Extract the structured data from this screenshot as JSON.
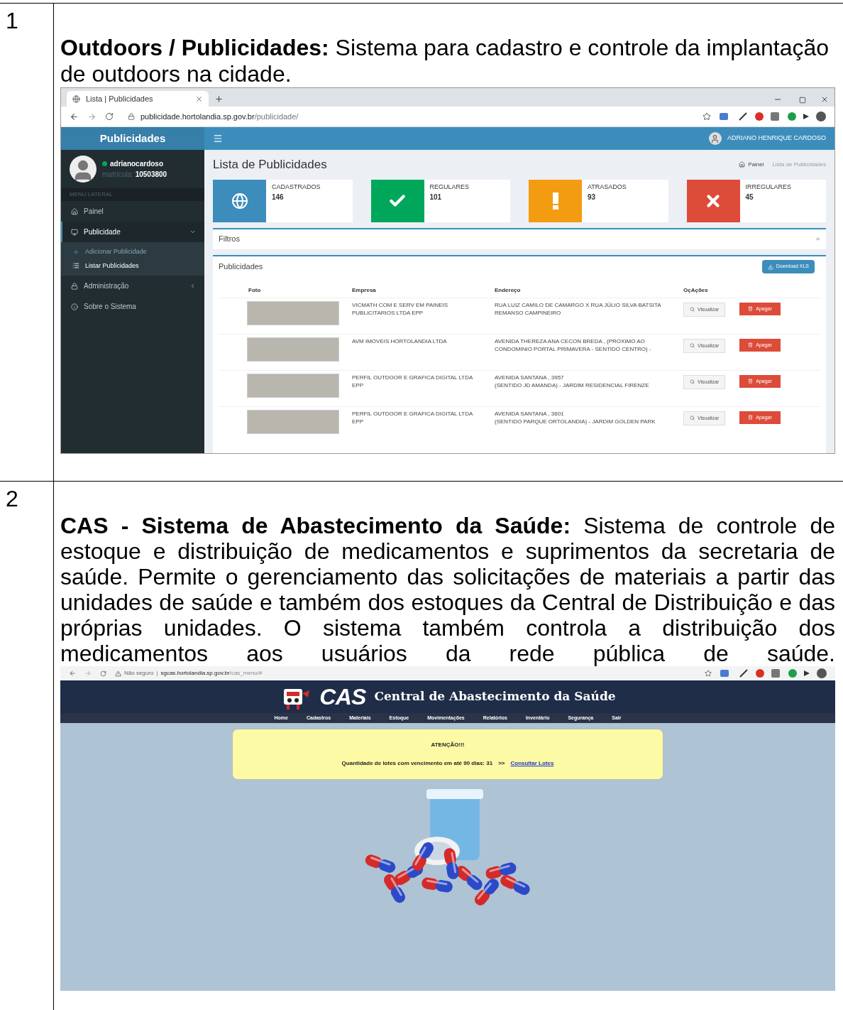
{
  "entries": [
    {
      "kind": "publicidades",
      "number": "1",
      "description": "**Outdoors / Publicidades:** Sistema para cadastro e controle da implantação de outdoors na cidade.",
      "browser": {
        "tab_title": "Lista | Publicidades",
        "url_host": "publicidade.hortolandia.sp.gov.br",
        "url_path": "/publicidade/"
      },
      "app": {
        "brand": "Publicidades",
        "user": "ADRIANO HENRIQUE CARDOSO",
        "username": "adrianocardoso",
        "matricula_label": "matrícula:",
        "matricula": "10503800",
        "menu_header": "MENU LATERAL",
        "menu": [
          {
            "kind": "link",
            "label": "Painel",
            "selected": false
          },
          {
            "kind": "group",
            "label": "Publicidade",
            "selected": true,
            "expanded": true,
            "children": [
              {
                "label": "Adicionar Publicidade",
                "selected": false
              },
              {
                "label": "Listar Publicidades",
                "selected": true
              }
            ]
          },
          {
            "kind": "group",
            "label": "Administração",
            "selected": false,
            "expanded": false
          },
          {
            "kind": "link",
            "label": "Sobre o Sistema",
            "selected": false
          }
        ],
        "page_title": "Lista de Publicidades",
        "breadcrumb": [
          "Painel",
          "Lista de Publicidades"
        ],
        "stats": [
          {
            "label": "CADASTRADOS",
            "value": "146",
            "color": "#3c8dbc"
          },
          {
            "label": "REGULARES",
            "value": "101",
            "color": "#00a65a"
          },
          {
            "label": "ATRASADOS",
            "value": "93",
            "color": "#f39c12"
          },
          {
            "label": "IRREGULARES",
            "value": "45",
            "color": "#dd4b39"
          }
        ],
        "filters": {
          "title": "Filtros",
          "toggle": "+"
        },
        "panel": {
          "title": "Publicidades",
          "button": "Download XLS",
          "columns": [
            "Foto",
            "Empresa",
            "Endereço",
            "OçAções"
          ],
          "rows": [
            {
              "empresa": "VICMATH COM E SERV EM PAINEIS PUBLICITARIOS LTDA EPP",
              "endereco": [
                "RUA LUIZ CAMILO DE CAMARGO X RUA JÚLIO SILVA BATSITA",
                "REMANSO CAMPINEIRO"
              ],
              "view": "Visualizar",
              "delete": "Apagar"
            },
            {
              "empresa": "AVM IMOVEIS HORTOLANDIA LTDA",
              "endereco": [
                "AVENIDA THEREZA ANA CECON BREDA , (PROXIMO AO CONDOMINIO PORTAL PRIMAVERA - SENTIDO CENTRO) -"
              ],
              "view": "Visualizar",
              "delete": "Apagar"
            },
            {
              "empresa": "PERFIL OUTDOOR E GRAFICA DIGITAL LTDA EPP",
              "endereco": [
                "AVENIDA SANTANA , 3957",
                "(SENTIDO JD AMANDA) - JARDIM RESIDENCIAL FIRENZE"
              ],
              "view": "Visualizar",
              "delete": "Apagar"
            },
            {
              "empresa": "PERFIL OUTDOOR E GRAFICA DIGITAL LTDA EPP",
              "endereco": [
                "AVENIDA SANTANA , 3601",
                "(SENTIDO PARQUE ORTOLANDIA) - JARDIM GOLDEN PARK"
              ],
              "view": "Visualizar",
              "delete": "Apagar"
            }
          ]
        }
      }
    },
    {
      "kind": "cas",
      "number": "2",
      "description": "**CAS - Sistema de Abastecimento da Saúde:** Sistema de controle de estoque e distribuição de medicamentos e suprimentos da secretaria de saúde. Permite o gerenciamento das solicitações de materiais a partir das unidades de saúde e também dos estoques da Central de Distribuição e das próprias unidades. O sistema também controla a distribuição dos medicamentos aos usuários da rede pública de saúde.",
      "browser": {
        "security": "Não seguro",
        "separator": "|",
        "url_host": "sgcas.hortolandia.sp.gov.br",
        "url_path": "/cas_menu/#"
      },
      "app": {
        "logo": "CAS",
        "subtitle": "Central de Abastecimento da Saúde",
        "menu": [
          "Home",
          "Cadastros",
          "Materiais",
          "Estoque",
          "Movimentações",
          "Relatórios",
          "Inventário",
          "Segurança",
          "Sair"
        ],
        "alert": {
          "title": "ATENÇÃO!!!",
          "message": "Quantidade de lotes com vencimento em até 90 dias: 31",
          "link_prefix": ">>",
          "link": "Consultar Lotes"
        }
      }
    }
  ]
}
